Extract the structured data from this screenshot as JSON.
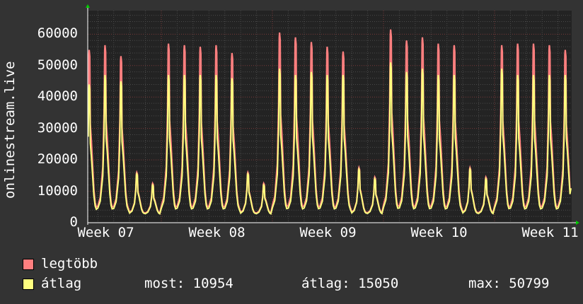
{
  "chart_data": {
    "type": "line",
    "ylabel": "onlinestream.live",
    "ylim": [
      0,
      67500
    ],
    "yticks": [
      0,
      10000,
      20000,
      30000,
      40000,
      50000,
      60000
    ],
    "xticks": [
      "Week 07",
      "Week 08",
      "Week 09",
      "Week 10",
      "Week 11"
    ],
    "grid": true,
    "legend_position": "bottom-left",
    "daily_peaks_note_hidden": false,
    "series": [
      {
        "name": "legtöbb",
        "color": "#ff7f7f",
        "values": [
          55000,
          56500,
          53000,
          16000,
          12500,
          57000,
          56500,
          56000,
          56500,
          54000,
          16000,
          12500,
          60500,
          59000,
          57500,
          56000,
          54500,
          17500,
          14500,
          61500,
          58000,
          59000,
          57000,
          56500,
          17500,
          14500,
          56500,
          57000,
          57000,
          56500,
          55000
        ]
      },
      {
        "name": "átlag",
        "color": "#ffff7f",
        "values": [
          44000,
          47000,
          45000,
          15500,
          12000,
          47000,
          47000,
          47000,
          47000,
          46000,
          15500,
          12000,
          49000,
          47000,
          48000,
          47000,
          47000,
          17000,
          14000,
          51000,
          48000,
          49000,
          47000,
          47000,
          17000,
          14000,
          49000,
          47000,
          47000,
          47000,
          47000
        ]
      }
    ],
    "last_value": 10954
  },
  "legend": {
    "max_label": "legtöbb",
    "avg_label": "átlag",
    "stat_now": "most: 10954",
    "stat_avg": "átlag: 15050",
    "stat_max": "max: 50799"
  }
}
